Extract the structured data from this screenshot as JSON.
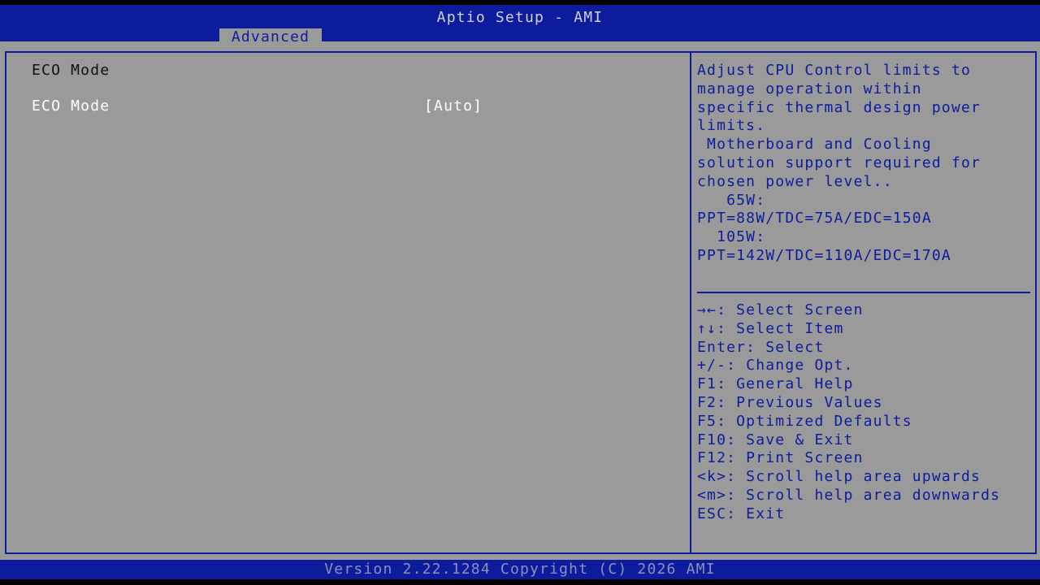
{
  "header": {
    "title": "Aptio Setup - AMI",
    "tabs": [
      {
        "label": "Advanced",
        "active": true
      }
    ]
  },
  "main": {
    "section_title": "ECO Mode",
    "items": [
      {
        "label": "ECO Mode",
        "value": "[Auto]",
        "selected": true
      }
    ]
  },
  "help": {
    "text": "Adjust CPU Control limits to\nmanage operation within\nspecific thermal design power\nlimits.\n Motherboard and Cooling\nsolution support required for\nchosen power level..\n   65W:\nPPT=88W/TDC=75A/EDC=150A\n  105W:\nPPT=142W/TDC=110A/EDC=170A",
    "keys": [
      "→←: Select Screen",
      "↑↓: Select Item",
      "Enter: Select",
      "+/-: Change Opt.",
      "F1: General Help",
      "F2: Previous Values",
      "F5: Optimized Defaults",
      "F10: Save & Exit",
      "F12: Print Screen",
      "<k>: Scroll help area upwards",
      "<m>: Scroll help area downwards",
      "ESC: Exit"
    ]
  },
  "footer": {
    "version": "Version 2.22.1284 Copyright (C) 2026 AMI"
  },
  "colors": {
    "bar_blue": "#0d1c9c",
    "panel_gray": "#9a9a9a",
    "selected_text": "#ffffff"
  }
}
